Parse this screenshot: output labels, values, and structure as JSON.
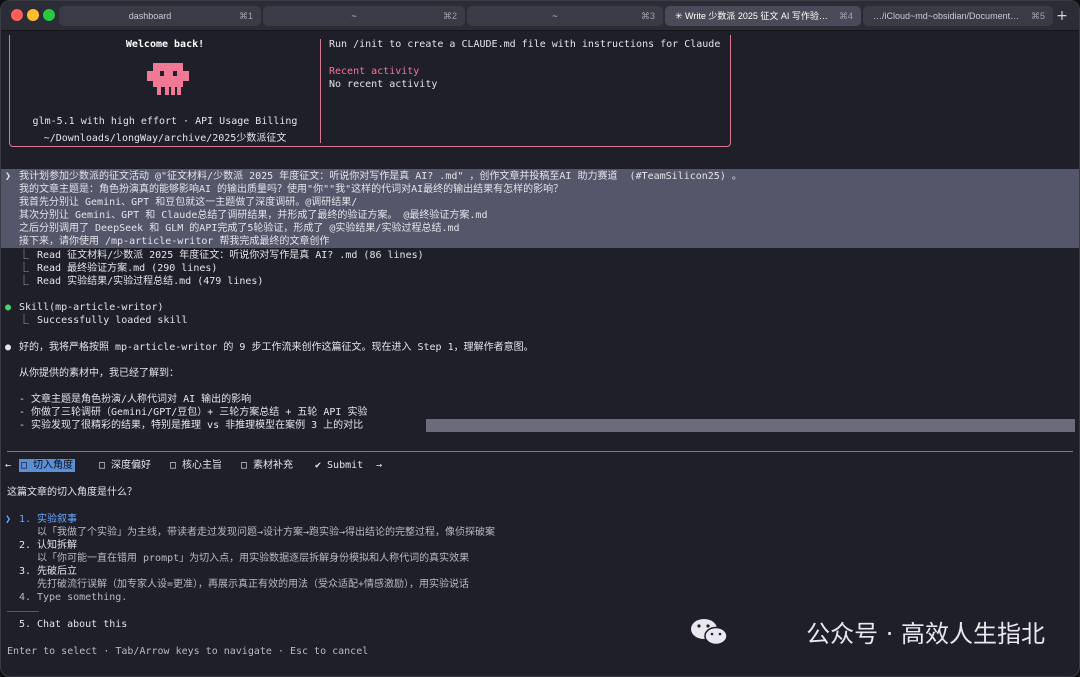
{
  "tabs": [
    {
      "title": "dashboard",
      "key": "⌘1"
    },
    {
      "title": "~",
      "key": "⌘2"
    },
    {
      "title": "~",
      "key": "⌘3"
    },
    {
      "title": "✳ Write 少数派 2025 征文 AI 写作验证…",
      "key": "⌘4"
    },
    {
      "title": "…/iCloud~md~obsidian/Documents/…",
      "key": "⌘5"
    }
  ],
  "new_tab": "+",
  "welcome": {
    "title": "Welcome back!",
    "model_line": "glm-5.1 with high effort · API Usage Billing",
    "path_line": "~/Downloads/longWay/archive/2025少数派征文",
    "tip": "Run /init to create a CLAUDE.md file with instructions for Claude",
    "recent_title": "Recent activity",
    "recent_text": "No recent activity"
  },
  "prompt": {
    "marker": "❯",
    "lines": [
      "我计划参加少数派的征文活动 @\"征文材料/少数派 2025 年度征文：听说你对写作是真 AI? .md\" ，创作文章并投稿至AI 助力赛道  (#TeamSilicon25) 。",
      "我的文章主题是：角色扮演真的能够影响AI 的输出质量吗？使用\"你\"\"我\"这样的代词对AI最终的输出结果有怎样的影响？",
      "我首先分别让 Gemini、GPT 和豆包就这一主题做了深度调研。@调研结果/",
      "其次分别让 Gemini、GPT 和 Claude总结了调研结果，并形成了最终的验证方案。 @最终验证方案.md",
      "之后分别调用了 DeepSeek 和 GLM 的API完成了5轮验证，形成了 @实验结果/实验过程总结.md",
      "接下来，请你使用 /mp-article-writor 帮我完成最终的文章创作"
    ]
  },
  "reads": [
    "Read 征文材料/少数派 2025 年度征文：听说你对写作是真 AI? .md (86 lines)",
    "Read 最终验证方案.md (290 lines)",
    "Read 实验结果/实验过程总结.md (479 lines)"
  ],
  "skill": {
    "bullet": "●",
    "name": "Skill(mp-article-writor)",
    "result": "Successfully loaded skill"
  },
  "response": {
    "bullet": "●",
    "intro": "好的，我将严格按照 mp-article-writor 的 9 步工作流来创作这篇征文。现在进入 Step 1，理解作者意图。",
    "known": "从你提供的素材中，我已经了解到：",
    "points": [
      "- 文章主题是角色扮演/人称代词对 AI 输出的影响",
      "- 你做了三轮调研（Gemini/GPT/豆包）+ 三轮方案总结 + 五轮 API 实验",
      "- 实验发现了很精彩的结果，特别是推理 vs 非推理模型在案例 3 上的对比"
    ]
  },
  "question_nav": {
    "left_arrow": "←",
    "right_arrow": "→",
    "items": [
      {
        "label": "□ 切入角度",
        "active": true
      },
      {
        "label": "□ 深度偏好",
        "active": false
      },
      {
        "label": "□ 核心主旨",
        "active": false
      },
      {
        "label": "□ 素材补充",
        "active": false
      },
      {
        "label": "✔ Submit",
        "active": false
      }
    ]
  },
  "question": "这篇文章的切入角度是什么？",
  "options": [
    {
      "num": "1.",
      "title": "实验叙事",
      "desc": "以「我做了个实验」为主线，带读者走过发现问题→设计方案→跑实验→得出结论的完整过程，像侦探破案"
    },
    {
      "num": "2.",
      "title": "认知拆解",
      "desc": "以「你可能一直在错用 prompt」为切入点，用实验数据逐层拆解身份模拟和人称代词的真实效果"
    },
    {
      "num": "3.",
      "title": "先破后立",
      "desc": "先打破流行误解（加专家人设=更准），再展示真正有效的用法（受众适配+情感激励），用实验说话"
    },
    {
      "num": "4.",
      "title": "Type something.",
      "desc": ""
    },
    {
      "num": "5.",
      "title": "Chat about this",
      "desc": ""
    }
  ],
  "selected_marker": "❯",
  "footer_hint": "Enter to select · Tab/Arrow keys to navigate · Esc to cancel",
  "watermark": "公众号 · 高效人生指北",
  "colors": {
    "accent_pink": "#d97a91",
    "selection_blue": "#5b8fd6",
    "success_green": "#42d26a"
  }
}
